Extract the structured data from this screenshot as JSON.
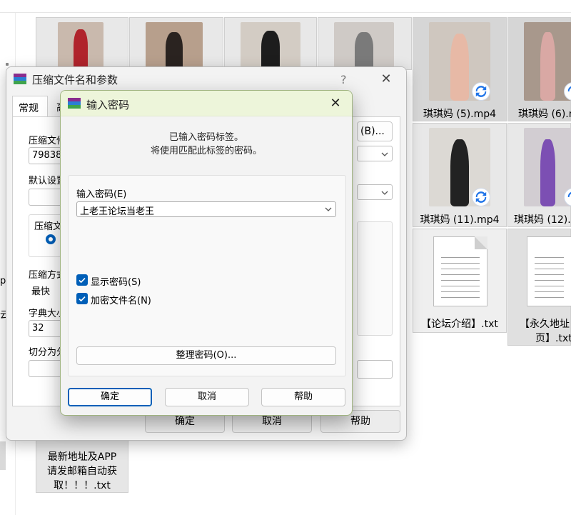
{
  "explorer": {
    "files": [
      {
        "label": ""
      },
      {
        "label": ""
      },
      {
        "label": ""
      },
      {
        "label": ""
      },
      {
        "label": "琪琪妈 (5).mp4"
      },
      {
        "label": "琪琪妈 (6).n"
      },
      {
        "label": "琪琪妈 (11).mp4"
      },
      {
        "label": "琪琪妈 (12).r"
      },
      {
        "label": "【论坛介绍】.txt"
      },
      {
        "label_line1": "【永久地址",
        "label_line2": "页】.txt"
      },
      {
        "label_line1": "最新地址及APP",
        "label_line2": "请发邮箱自动获",
        "label_line3": "取！！！.txt"
      }
    ],
    "side_fragments": [
      "p",
      "云"
    ]
  },
  "archive_dialog": {
    "title": "压缩文件名和参数",
    "help": "?",
    "close": "✕",
    "tabs": [
      "常规",
      "高"
    ],
    "archive_name_label": "压缩文件",
    "archive_name_value": "79838",
    "browse_label": "(B)...",
    "default_profile_label": "默认设置",
    "archive_format_label": "压缩文",
    "radio_label": "R",
    "method_label": "压缩方式",
    "method_value": "最快",
    "dict_label": "字典大小",
    "dict_value": "32",
    "split_label": "切分为分",
    "ok": "确定",
    "cancel": "取消",
    "help_btn": "帮助"
  },
  "password_dialog": {
    "title": "输入密码",
    "close": "✕",
    "info_line1": "已输入密码标签。",
    "info_line2": "将使用匹配此标签的密码。",
    "password_label": "输入密码(E)",
    "password_value": "上老王论坛当老王",
    "show_password": "显示密码(S)",
    "encrypt_names": "加密文件名(N)",
    "organize": "整理密码(O)...",
    "ok": "确定",
    "cancel": "取消",
    "help": "帮助"
  },
  "colors": {
    "accent": "#005fb8",
    "title_green": "#edf5da",
    "tile_gray": "#e8e8e8"
  }
}
